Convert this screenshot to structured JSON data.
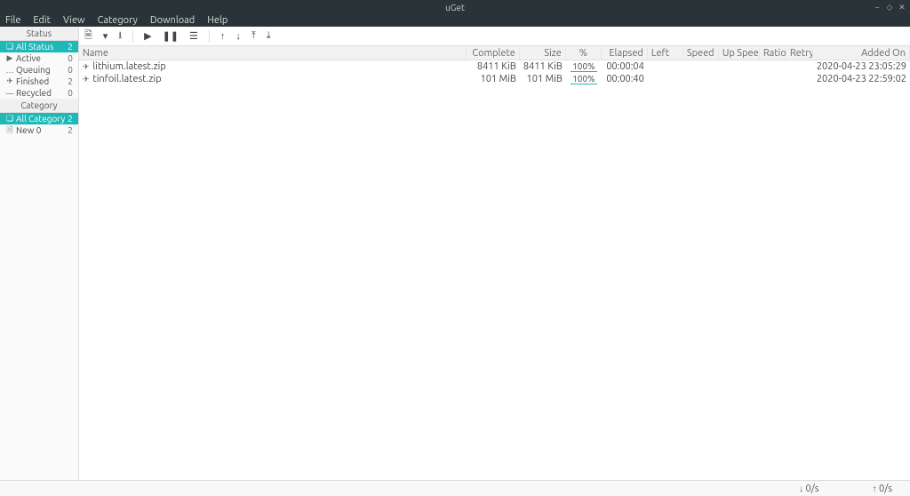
{
  "window": {
    "title": "uGet"
  },
  "menu": {
    "file": "File",
    "edit": "Edit",
    "view": "View",
    "category": "Category",
    "download": "Download",
    "help": "Help"
  },
  "sidebar": {
    "status_header": "Status",
    "status_items": [
      {
        "label": "All Status",
        "count": "2"
      },
      {
        "label": "Active",
        "count": "0"
      },
      {
        "label": "Queuing",
        "count": "0"
      },
      {
        "label": "Finished",
        "count": "2"
      },
      {
        "label": "Recycled",
        "count": "0"
      }
    ],
    "category_header": "Category",
    "category_items": [
      {
        "label": "All Category",
        "count": "2"
      },
      {
        "label": "New 0",
        "count": "2"
      }
    ]
  },
  "columns": {
    "name": "Name",
    "complete": "Complete",
    "size": "Size",
    "pct": "%",
    "elapsed": "Elapsed",
    "left": "Left",
    "speed": "Speed",
    "upspeed": "Up Speed",
    "ratio": "Ratio",
    "retry": "Retry",
    "added": "Added On"
  },
  "rows": [
    {
      "name": "lithium.latest.zip",
      "complete": "8411 KiB",
      "size": "8411 KiB",
      "pct": "100%",
      "elapsed": "00:00:04",
      "added": "2020-04-23 23:05:29"
    },
    {
      "name": "tinfoil.latest.zip",
      "complete": "101 MiB",
      "size": "101 MiB",
      "pct": "100%",
      "elapsed": "00:00:40",
      "added": "2020-04-23 22:59:02"
    }
  ],
  "status": {
    "down": "0/s",
    "up": "0/s"
  }
}
